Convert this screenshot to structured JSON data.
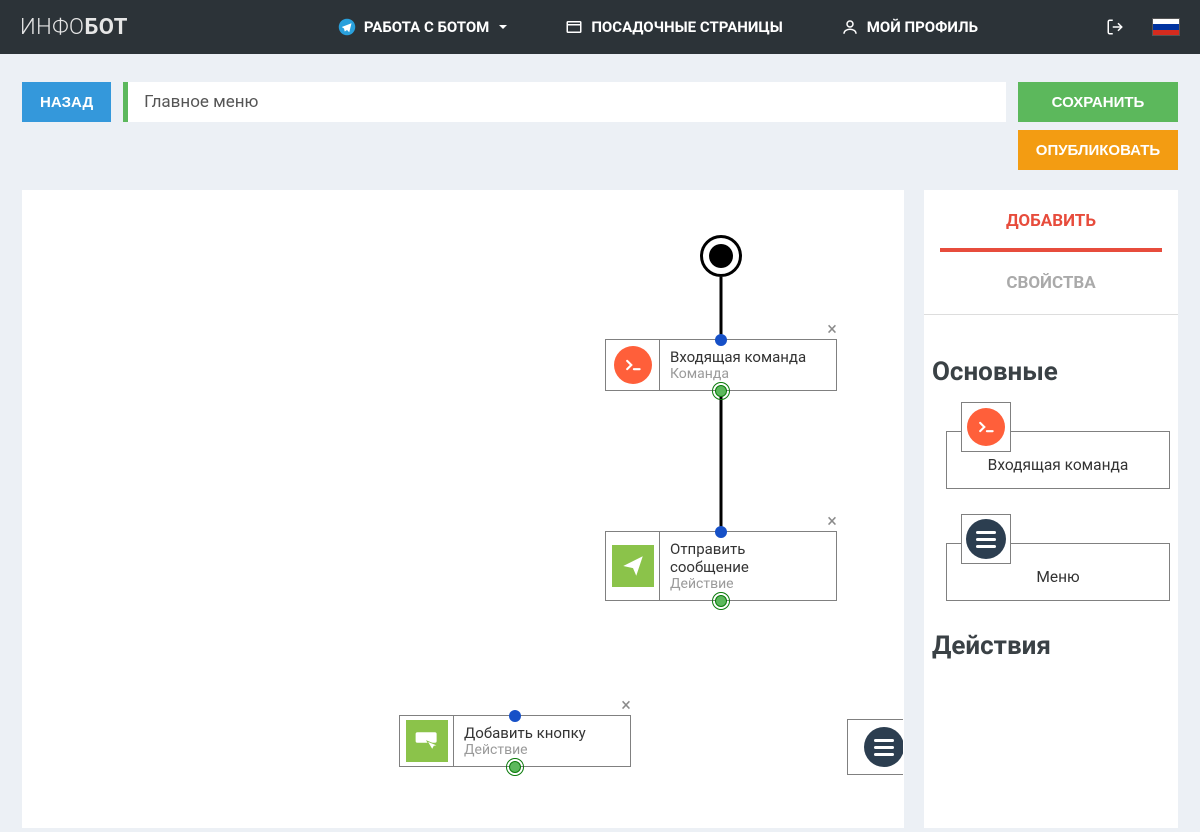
{
  "header": {
    "logo_light": "ИНФО",
    "logo_bold": "БОТ",
    "nav": {
      "bot": "РАБОТА С БОТОМ",
      "pages": "ПОСАДОЧНЫЕ СТРАНИЦЫ",
      "profile": "МОЙ ПРОФИЛЬ"
    }
  },
  "toolbar": {
    "back": "НАЗАД",
    "title_value": "Главное меню",
    "save": "СОХРАНИТЬ",
    "publish": "ОПУБЛИКОВАТЬ"
  },
  "panel": {
    "tab_add": "ДОБАВИТЬ",
    "tab_props": "СВОЙСТВА",
    "section_main": "Основные",
    "section_actions": "Действия",
    "item_command": "Входящая команда",
    "item_menu": "Меню"
  },
  "nodes": {
    "cmd": {
      "title": "Входящая команда",
      "sub": "Команда"
    },
    "send": {
      "title": "Отправить сообщение",
      "sub": "Действие"
    },
    "addbtn": {
      "title": "Добавить кнопку",
      "sub": "Действие"
    }
  },
  "colors": {
    "accent_blue": "#3498db",
    "accent_green": "#5cb85c",
    "accent_orange": "#f39c12",
    "accent_red": "#e74c3c",
    "cmd_icon": "#ff5f3a",
    "action_icon": "#8bc34a"
  }
}
